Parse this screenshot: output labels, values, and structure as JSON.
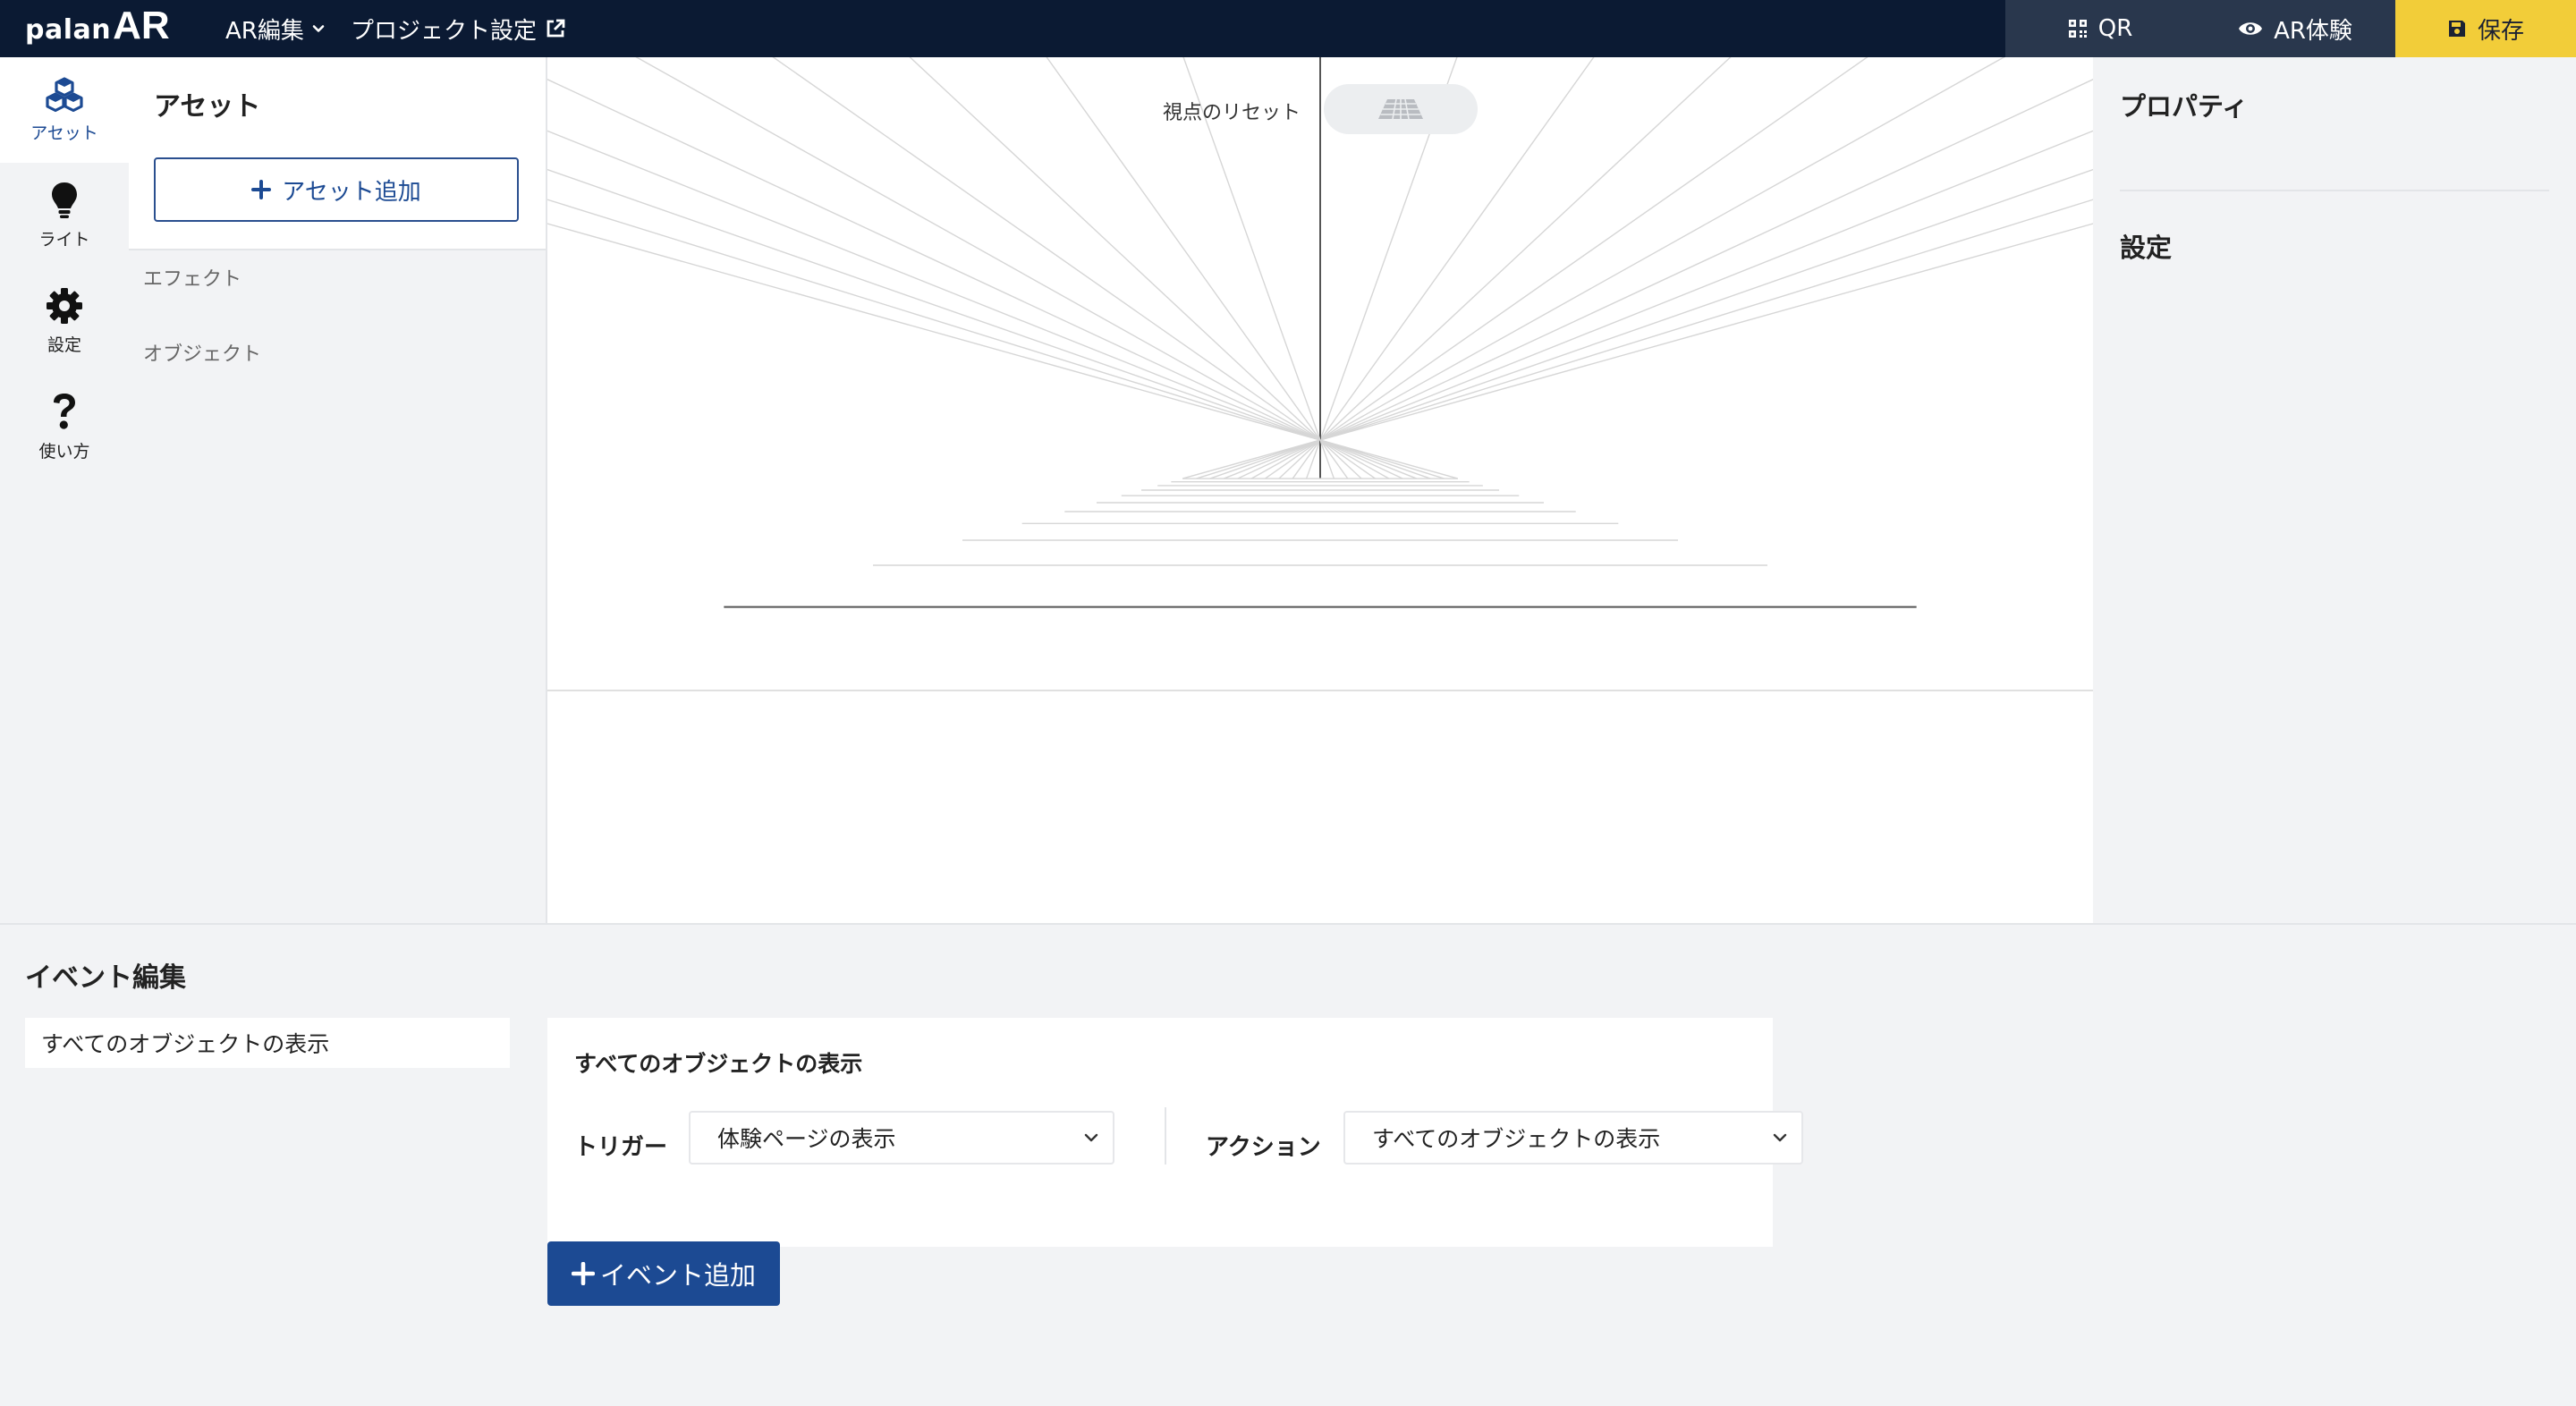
{
  "header": {
    "logo_text_small": "palan",
    "logo_text_large": "AR",
    "nav_ar_edit": "AR編集",
    "nav_project_settings": "プロジェクト設定",
    "btn_qr": "QR",
    "btn_ar_experience": "AR体験",
    "btn_save": "保存"
  },
  "sidebar": {
    "items": [
      {
        "label": "アセット",
        "icon": "cubes-icon",
        "active": true
      },
      {
        "label": "ライト",
        "icon": "lightbulb-icon"
      },
      {
        "label": "設定",
        "icon": "gear-icon"
      },
      {
        "label": "使い方",
        "icon": "question-icon"
      }
    ]
  },
  "assets": {
    "title": "アセット",
    "add_button": "アセット追加",
    "categories": [
      "エフェクト",
      "オブジェクト"
    ]
  },
  "viewport": {
    "reset_view_label": "視点のリセット",
    "reset_icon": "grid-plane-icon"
  },
  "properties": {
    "title": "プロパティ",
    "settings_title": "設定"
  },
  "events": {
    "title": "イベント編集",
    "list": [
      "すべてのオブジェクトの表示"
    ],
    "card": {
      "title": "すべてのオブジェクトの表示",
      "trigger_label": "トリガー",
      "trigger_value": "体験ページの表示",
      "action_label": "アクション",
      "action_value": "すべてのオブジェクトの表示"
    },
    "add_button": "イベント追加"
  },
  "colors": {
    "header_bg": "#0b1a33",
    "header_button_bg": "#29374d",
    "save_bg": "#f2cd39",
    "accent": "#1c4a93",
    "panel_bg": "#f2f3f5"
  }
}
